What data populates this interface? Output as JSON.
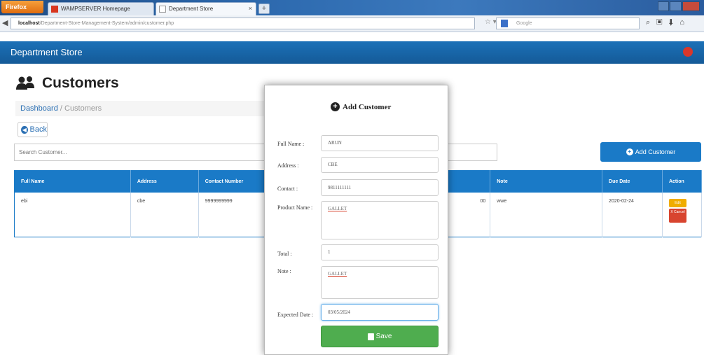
{
  "browser": {
    "menu_button": "Firefox",
    "tabs": [
      {
        "label": "WAMPSERVER Homepage"
      },
      {
        "label": "Department Store"
      }
    ],
    "url_host": "localhost",
    "url_path": "/Department-Store-Management-System/admin/customer.php",
    "search_placeholder": "Google"
  },
  "app": {
    "title": "Department Store",
    "accent_color": "#1a7ac7"
  },
  "page": {
    "title": "Customers",
    "breadcrumb": {
      "home": "Dashboard",
      "separator": " / ",
      "current": "Customers"
    },
    "back_label": "Back",
    "search_placeholder": "Search Customer...",
    "add_customer_label": "Add Customer"
  },
  "table": {
    "columns": [
      "Full Name",
      "Address",
      "Contact Number",
      "",
      "Note",
      "Due Date",
      "Action"
    ],
    "rows": [
      {
        "full_name": "ebi",
        "address": "cbe",
        "contact": "9999999999",
        "hidden": "00",
        "note": "wwe",
        "due_date": "2020-02-24",
        "edit": "Edit",
        "cancel": "X Cancel"
      }
    ]
  },
  "modal": {
    "title": "Add Customer",
    "fields": [
      {
        "label": "Full Name :",
        "value": "ARUN"
      },
      {
        "label": "Address :",
        "value": "CBE"
      },
      {
        "label": "Contact :",
        "value": "9811111111"
      },
      {
        "label": "Product Name :",
        "value": "GALLET"
      },
      {
        "label": "Total :",
        "value": "1"
      },
      {
        "label": "Note :",
        "value": "GALLET"
      },
      {
        "label": "Expected Date :",
        "value": "03/05/2024"
      }
    ],
    "save_label": "Save"
  }
}
